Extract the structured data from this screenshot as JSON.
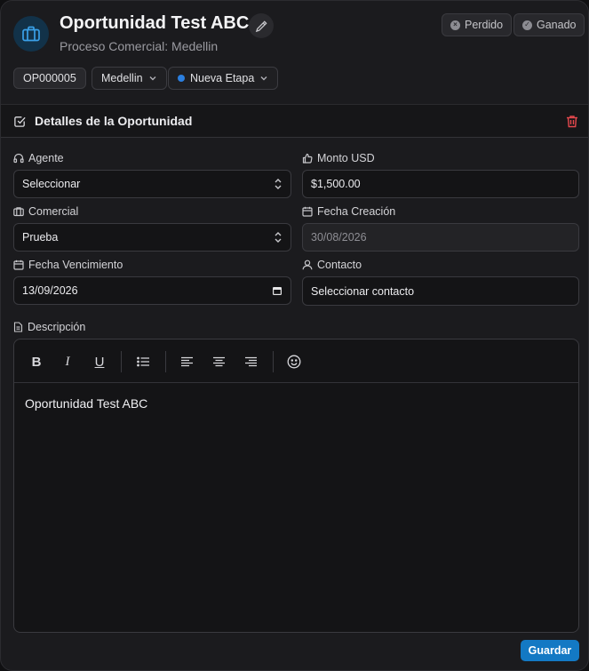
{
  "header": {
    "title": "Oportunidad Test ABC",
    "subtitle": "Proceso Comercial: Medellin",
    "lost_label": "Perdido",
    "won_label": "Ganado",
    "code": "OP000005",
    "city": "Medellin",
    "stage": "Nueva Etapa",
    "stage_color": "#2b7fe0",
    "accent_color": "#1379c4"
  },
  "section": {
    "title": "Detalles de la Oportunidad",
    "delete_color": "#e5484d"
  },
  "form": {
    "agent": {
      "label": "Agente",
      "value": "Seleccionar"
    },
    "amount": {
      "label": "Monto USD",
      "value": "$1,500.00"
    },
    "commercial": {
      "label": "Comercial",
      "value": "Prueba"
    },
    "created": {
      "label": "Fecha Creación",
      "value": "30/08/2026"
    },
    "due": {
      "label": "Fecha Vencimiento",
      "value": "13/09/2026"
    },
    "contact": {
      "label": "Contacto",
      "value": "Seleccionar contacto"
    },
    "description": {
      "label": "Descripción",
      "value": "Oportunidad Test ABC"
    }
  },
  "toolbar": {
    "bold": "B",
    "italic": "I",
    "underline": "U"
  },
  "actions": {
    "save_label": "Guardar"
  }
}
